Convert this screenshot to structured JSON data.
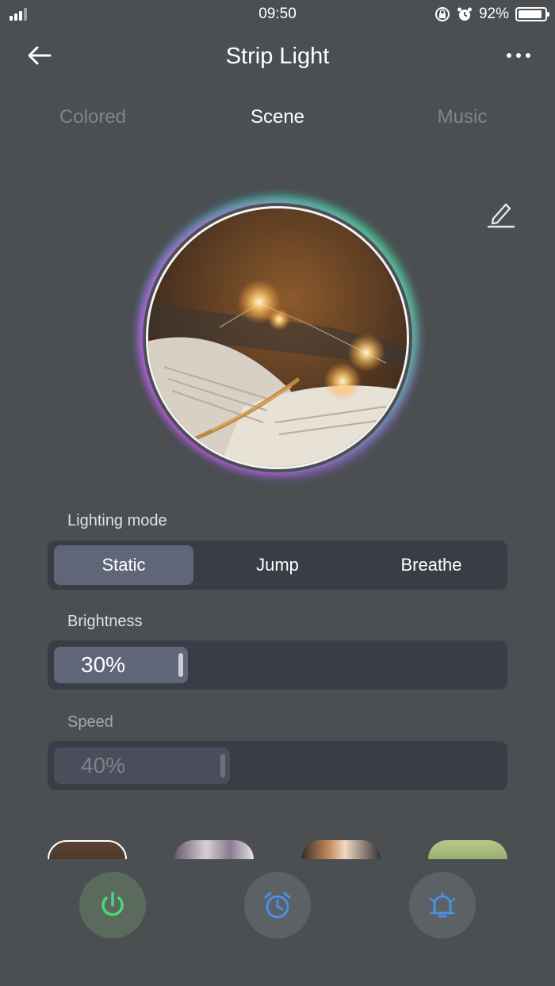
{
  "status_bar": {
    "time": "09:50",
    "battery_percent": "92%",
    "battery_level": 0.92
  },
  "header": {
    "title": "Strip Light"
  },
  "tabs": [
    {
      "label": "Colored"
    },
    {
      "label": "Scene"
    },
    {
      "label": "Music"
    }
  ],
  "active_tab": "Scene",
  "lighting_mode": {
    "label": "Lighting mode",
    "options": [
      "Static",
      "Jump",
      "Breathe"
    ],
    "selected": "Static"
  },
  "brightness": {
    "label": "Brightness",
    "value_text": "30%",
    "value": 0.3
  },
  "speed": {
    "label": "Speed",
    "value_text": "40%",
    "value": 0.4
  },
  "colors": {
    "background": "#4b4f52",
    "panel": "#3b3d46",
    "selected": "#5f6678",
    "power_green": "#4cd77a",
    "accent_blue": "#4a90e2"
  },
  "icons": {
    "back": "arrow-left-icon",
    "more": "more-dots-icon",
    "edit": "pencil-icon",
    "power": "power-icon",
    "timer": "alarm-clock-icon",
    "alarm": "bell-icon"
  }
}
